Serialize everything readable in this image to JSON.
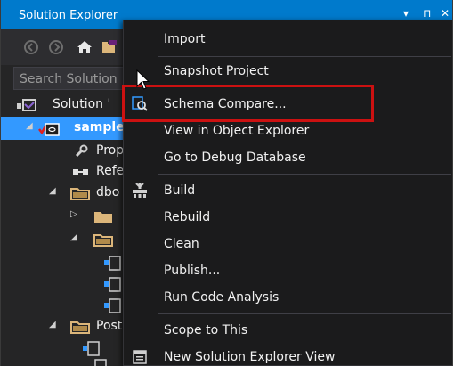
{
  "window": {
    "title": "Solution Explorer",
    "title_glyphs": [
      "▾",
      "⊓",
      "✕"
    ]
  },
  "toolbar": {
    "icons": [
      "back-icon",
      "forward-icon",
      "home-icon",
      "solution-folder-icon"
    ]
  },
  "search": {
    "placeholder": "Search Solution"
  },
  "tree": {
    "items": [
      {
        "label": "Solution '",
        "icon": "solution-icon"
      },
      {
        "label": "sample",
        "icon": "database-project-icon",
        "selected": true
      },
      {
        "label": "Prop",
        "icon": "wrench-icon"
      },
      {
        "label": "Refe",
        "icon": "references-icon"
      },
      {
        "label": "dbo",
        "icon": "folder-icon"
      },
      {
        "label": "",
        "icon": "folder-icon"
      },
      {
        "label": "",
        "icon": "folder-icon"
      },
      {
        "label": "Post",
        "icon": "folder-icon"
      }
    ]
  },
  "context_menu": {
    "items": [
      {
        "label": "Import",
        "icon": null
      },
      {
        "label": "Snapshot Project",
        "icon": null
      },
      {
        "label": "Schema Compare...",
        "icon": "schema-compare-icon",
        "highlighted": true
      },
      {
        "label": "View in Object Explorer",
        "icon": null
      },
      {
        "label": "Go to Debug Database",
        "icon": null
      },
      {
        "label": "Build",
        "icon": "build-icon"
      },
      {
        "label": "Rebuild",
        "icon": null
      },
      {
        "label": "Clean",
        "icon": null
      },
      {
        "label": "Publish...",
        "icon": null
      },
      {
        "label": "Run Code Analysis",
        "icon": null
      },
      {
        "label": "Scope to This",
        "icon": null
      },
      {
        "label": "New Solution Explorer View",
        "icon": "new-view-icon"
      }
    ]
  },
  "colors": {
    "accent": "#007acc",
    "selection": "#3399ff",
    "highlight_border": "#cc1111",
    "menu_bg": "#1b1b1c",
    "panel_bg": "#252526"
  }
}
